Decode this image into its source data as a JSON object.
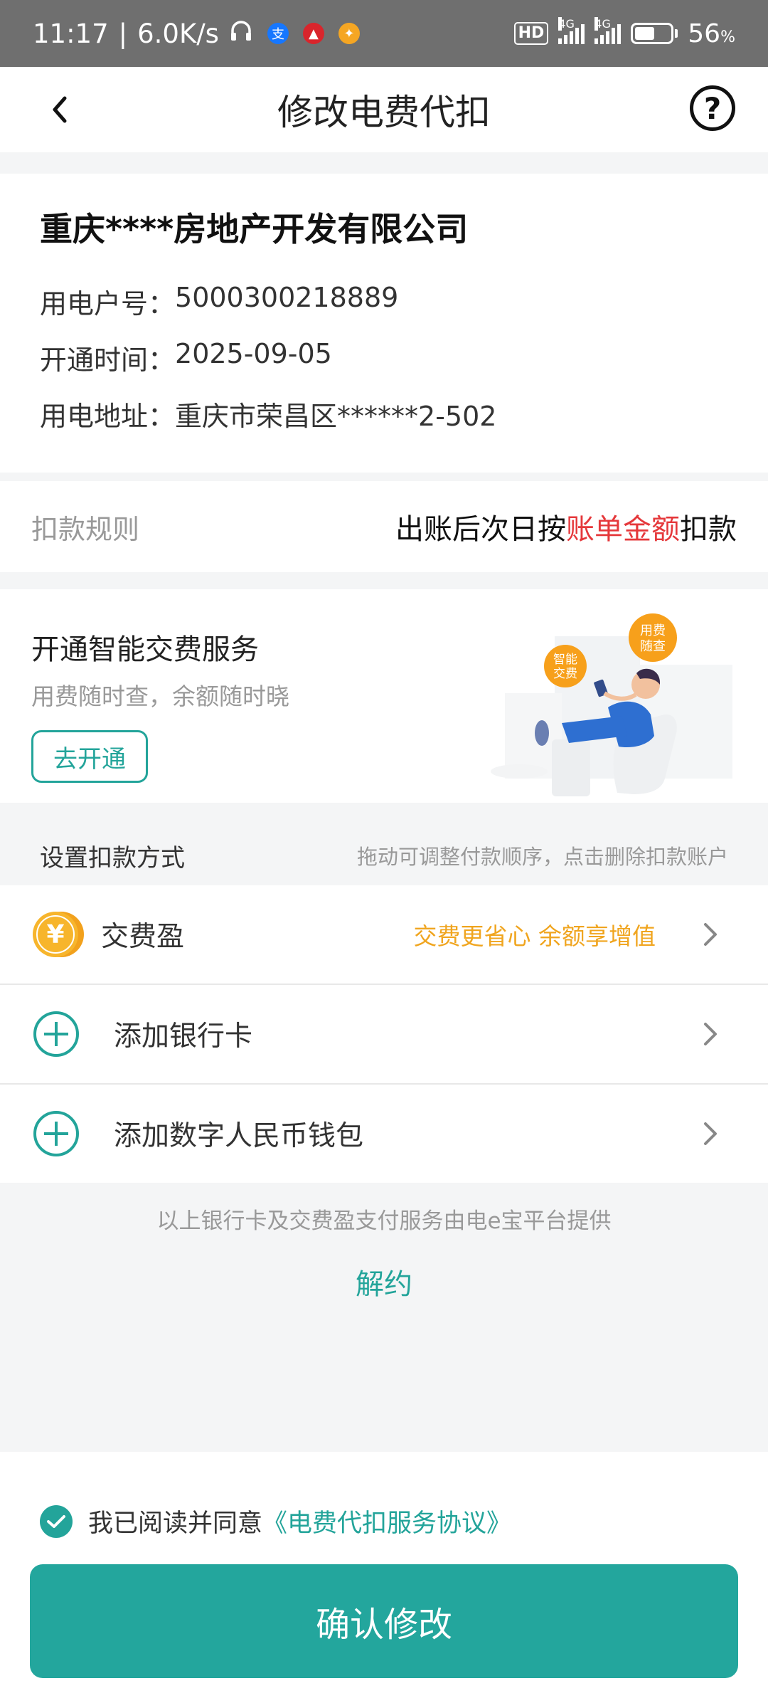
{
  "status_bar": {
    "time": "11:17",
    "separator": "|",
    "speed": "6.0K/s",
    "hd": "HD",
    "net1": "4G",
    "net2": "4G",
    "battery_percent": "56",
    "battery_unit": "%",
    "battery_level": 0.56
  },
  "nav": {
    "title": "修改电费代扣",
    "help": "?"
  },
  "account": {
    "company": "重庆****房地产开发有限公司",
    "account_no_label": "用电户号：",
    "account_no": "5000300218889",
    "open_date_label": "开通时间：",
    "open_date": "2025-09-05",
    "address_label": "用电地址：",
    "address": "重庆市荣昌区******2-502"
  },
  "rule": {
    "label": "扣款规则",
    "value_prefix": "出账后次日按",
    "value_highlight": "账单金额",
    "value_suffix": "扣款"
  },
  "promo": {
    "title": "开通智能交费服务",
    "subtitle": "用费随时查，余额随时晓",
    "button": "去开通",
    "bubble_left_line1": "智能",
    "bubble_left_line2": "交费",
    "bubble_right_line1": "用费",
    "bubble_right_line2": "随查"
  },
  "payment": {
    "title": "设置扣款方式",
    "hint": "拖动可调整付款顺序，点击删除扣款账户",
    "items": [
      {
        "label": "交费盈",
        "promo": "交费更省心 余额享增值",
        "icon": "yuan-coin-icon"
      },
      {
        "label": "添加银行卡",
        "icon": "plus-circle-icon"
      },
      {
        "label": "添加数字人民币钱包",
        "icon": "plus-circle-icon"
      }
    ],
    "footnote": "以上银行卡及交费盈支付服务由电e宝平台提供",
    "unbind": "解约"
  },
  "agreement": {
    "prefix": "我已阅读并同意",
    "link": "《电费代扣服务协议》",
    "checked": true
  },
  "confirm_button": "确认修改",
  "colors": {
    "accent": "#23a49a",
    "highlight_red": "#e5383b",
    "promo_orange": "#f0a51f",
    "status_bar_bg": "#6f6f6f"
  }
}
